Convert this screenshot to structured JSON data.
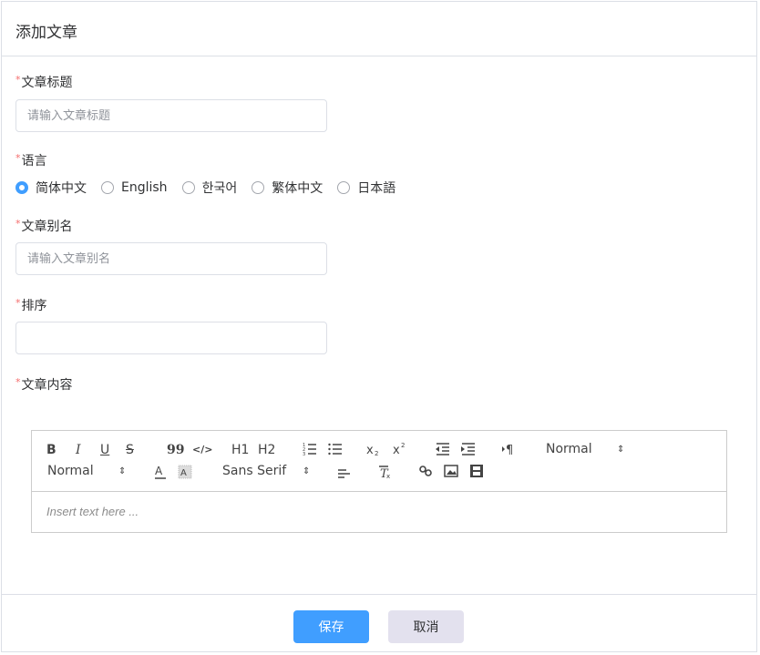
{
  "dialog": {
    "title": "添加文章"
  },
  "form": {
    "required_mark": "*",
    "title": {
      "label": "文章标题",
      "placeholder": "请输入文章标题",
      "value": ""
    },
    "language": {
      "label": "语言",
      "options": [
        "简体中文",
        "English",
        "한국어",
        "繁体中文",
        "日本語"
      ],
      "selected": "简体中文"
    },
    "alias": {
      "label": "文章别名",
      "placeholder": "请输入文章别名",
      "value": ""
    },
    "sort": {
      "label": "排序",
      "value": ""
    },
    "content": {
      "label": "文章内容"
    }
  },
  "editor": {
    "toolbar": {
      "bold": "B",
      "italic": "I",
      "underline": "U",
      "strike": "S",
      "blockquote": "99",
      "code": "</>",
      "h1": "H1",
      "h2": "H2",
      "header_picker": "Normal",
      "size_picker": "Normal",
      "font_picker": "Sans Serif",
      "picker_arrow": "⇕"
    },
    "placeholder": "Insert text here ..."
  },
  "footer": {
    "save_label": "保存",
    "cancel_label": "取消"
  },
  "colors": {
    "primary": "#409eff",
    "required": "#f56c6c",
    "border": "#dcdfe6"
  }
}
